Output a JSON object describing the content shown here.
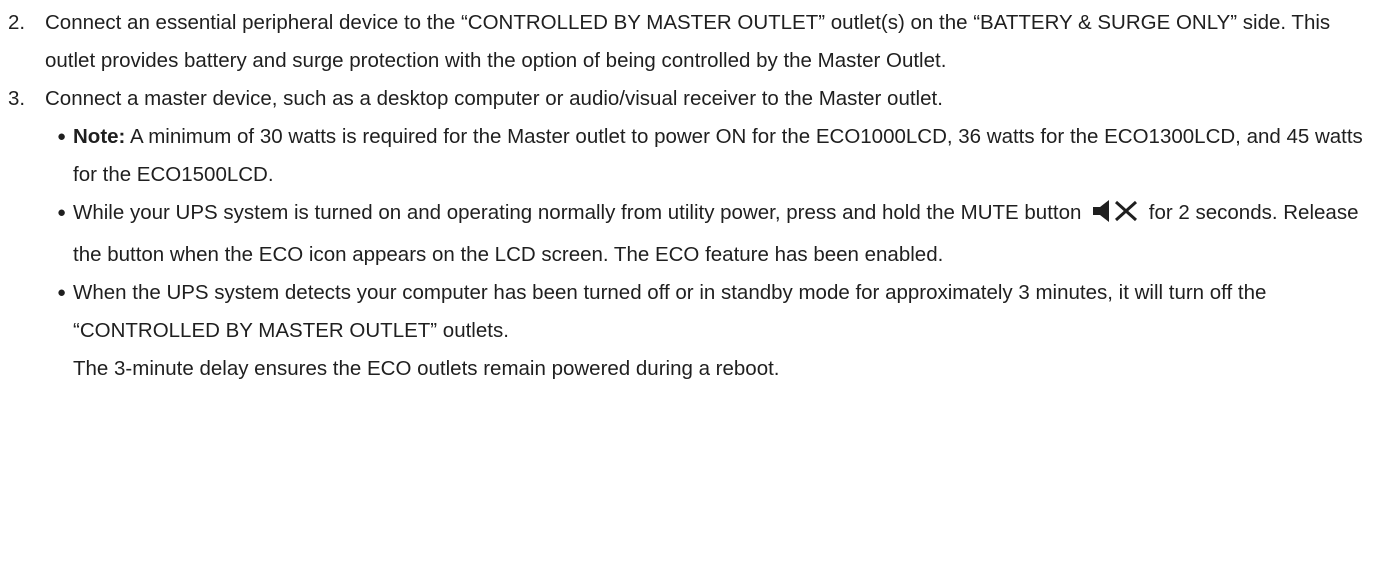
{
  "steps": [
    {
      "number": "2.",
      "text": "Connect an essential peripheral device to the “CONTROLLED BY MASTER OUTLET” outlet(s) on the “BATTERY & SURGE ONLY” side. This outlet provides battery and surge protection with the option of being controlled by the Master Outlet."
    },
    {
      "number": "3.",
      "text": "Connect a master device, such as a desktop computer or audio/visual receiver to the Master outlet.",
      "bullets": [
        {
          "label": "Note:",
          "text": " A minimum of 30 watts is required for the Master outlet to power ON for the ECO1000LCD, 36 watts for the ECO1300LCD, and 45 watts for the ECO1500LCD."
        },
        {
          "text_before_icon": "While your UPS system is turned on and operating normally from utility power, press and hold the MUTE button",
          "icon": "mute-speaker-icon",
          "text_after_icon": " for 2 seconds. Release the button when the ECO icon appears on the LCD screen. The ECO feature has been enabled."
        },
        {
          "text": "When the UPS system detects your computer has been turned off or in standby mode for approximately 3 minutes, it will turn off the “CONTROLLED BY MASTER OUTLET” outlets.",
          "continuation": "The 3-minute delay ensures the ECO outlets remain powered during a reboot."
        }
      ]
    }
  ]
}
